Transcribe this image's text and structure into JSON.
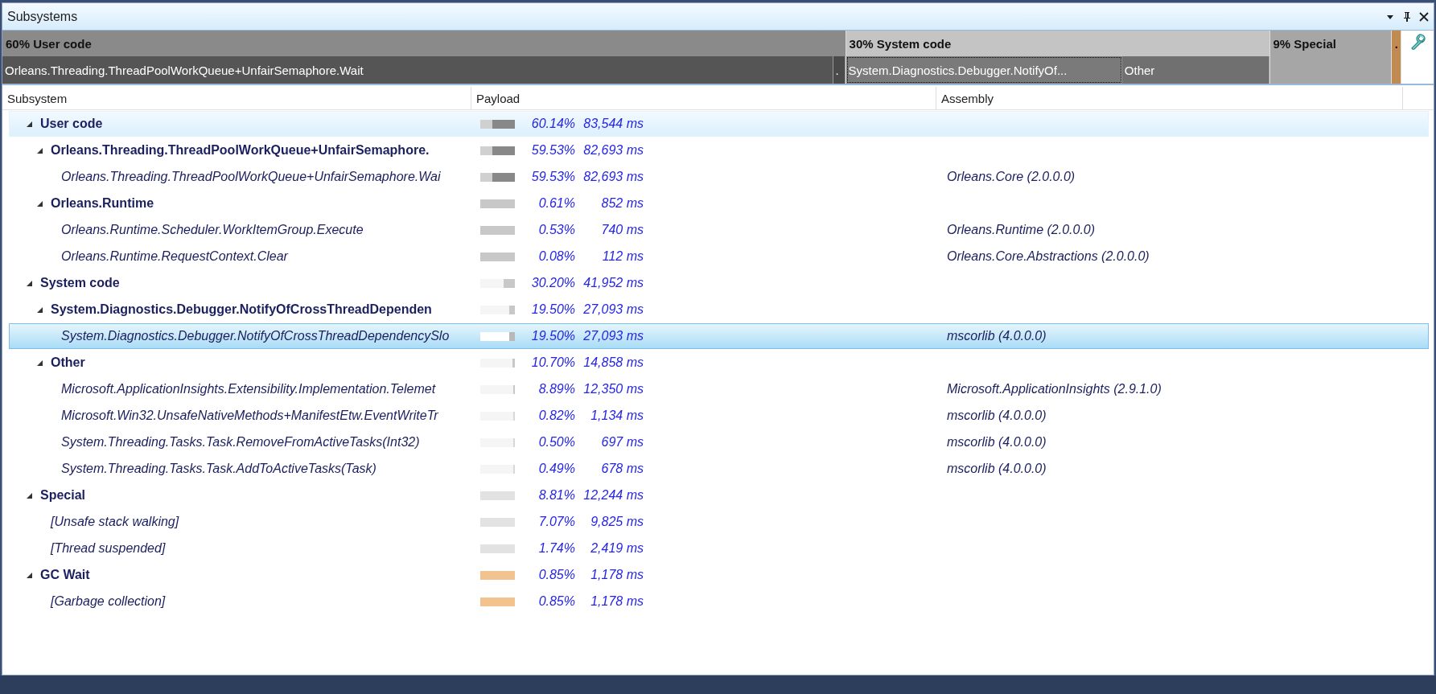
{
  "window": {
    "title": "Subsystems"
  },
  "breakdown": [
    {
      "label": "60% User code",
      "color": "#8a8a8a",
      "parts": [
        {
          "label": "Orleans.Threading.ThreadPoolWorkQueue+UnfairSemaphore.Wait",
          "color": "#555555",
          "selected": false
        },
        {
          "label": ".",
          "color": "#4a4a4a",
          "selected": false
        }
      ]
    },
    {
      "label": "30% System code",
      "color": "#c4c4c4",
      "parts": [
        {
          "label": "System.Diagnostics.Debugger.NotifyOf...",
          "color": "#7a7a7a",
          "selected": true
        },
        {
          "label": "Other",
          "color": "#707070",
          "selected": false
        }
      ]
    },
    {
      "label": "9% Special",
      "color": "#a6a6a6"
    },
    {
      "label": ".",
      "color": "#c08a50"
    }
  ],
  "table": {
    "columns": [
      "Subsystem",
      "Payload",
      "Assembly"
    ],
    "rows": [
      {
        "name": "User code",
        "expanded": true,
        "selected": false,
        "hovered": true,
        "percent": "60.14%",
        "time": "83,544 ms",
        "bar": {
          "kind": "split",
          "level": 0.65,
          "color": "#888888"
        },
        "children": [
          {
            "name": "Orleans.Threading.ThreadPoolWorkQueue+UnfairSemaphore.",
            "expanded": true,
            "selected": false,
            "hovered": false,
            "percent": "59.53%",
            "time": "82,693 ms",
            "bar": {
              "kind": "split",
              "level": 0.65,
              "color": "#888888"
            },
            "children": [
              {
                "name": "Orleans.Threading.ThreadPoolWorkQueue+UnfairSemaphore.Wai",
                "selected": false,
                "hovered": false,
                "percent": "59.53%",
                "time": "82,693 ms",
                "assembly": "Orleans.Core (2.0.0.0)",
                "bar": {
                  "kind": "split",
                  "level": 0.65,
                  "color": "#888888"
                }
              }
            ]
          },
          {
            "name": "Orleans.Runtime",
            "expanded": true,
            "selected": false,
            "hovered": false,
            "percent": "0.61%",
            "time": "852 ms",
            "bar": {
              "kind": "plain",
              "level": 1,
              "color": "#c8c8c8"
            },
            "children": [
              {
                "name": "Orleans.Runtime.Scheduler.WorkItemGroup.Execute",
                "selected": false,
                "hovered": false,
                "percent": "0.53%",
                "time": "740 ms",
                "assembly": "Orleans.Runtime (2.0.0.0)",
                "bar": {
                  "kind": "plain",
                  "level": 1,
                  "color": "#c8c8c8"
                }
              },
              {
                "name": "Orleans.Runtime.RequestContext.Clear",
                "selected": false,
                "hovered": false,
                "percent": "0.08%",
                "time": "112 ms",
                "assembly": "Orleans.Core.Abstractions (2.0.0.0)",
                "bar": {
                  "kind": "plain",
                  "level": 1,
                  "color": "#c8c8c8"
                }
              }
            ]
          }
        ]
      },
      {
        "name": "System code",
        "expanded": true,
        "selected": false,
        "hovered": false,
        "percent": "30.20%",
        "time": "41,952 ms",
        "bar": {
          "kind": "plain",
          "level": 0.33,
          "color": "#c8c8c8"
        },
        "children": [
          {
            "name": "System.Diagnostics.Debugger.NotifyOfCrossThreadDependen",
            "expanded": true,
            "selected": false,
            "hovered": false,
            "percent": "19.50%",
            "time": "27,093 ms",
            "bar": {
              "kind": "plain",
              "level": 0.16,
              "color": "#c8c8c8"
            },
            "children": [
              {
                "name": "System.Diagnostics.Debugger.NotifyOfCrossThreadDependencySlo",
                "selected": true,
                "hovered": false,
                "percent": "19.50%",
                "time": "27,093 ms",
                "assembly": "mscorlib (4.0.0.0)",
                "bar": {
                  "kind": "split",
                  "level": 0.16,
                  "color": "#b8b8b8"
                }
              }
            ]
          },
          {
            "name": "Other",
            "expanded": true,
            "selected": false,
            "hovered": false,
            "percent": "10.70%",
            "time": "14,858 ms",
            "bar": {
              "kind": "plain",
              "level": 0.06,
              "color": "#c8c8c8"
            },
            "children": [
              {
                "name": "Microsoft.ApplicationInsights.Extensibility.Implementation.Telemet",
                "selected": false,
                "hovered": false,
                "percent": "8.89%",
                "time": "12,350 ms",
                "assembly": "Microsoft.ApplicationInsights (2.9.1.0)",
                "bar": {
                  "kind": "plain",
                  "level": 0.05,
                  "color": "#c8c8c8"
                }
              },
              {
                "name": "Microsoft.Win32.UnsafeNativeMethods+ManifestEtw.EventWriteTr",
                "selected": false,
                "hovered": false,
                "percent": "0.82%",
                "time": "1,134 ms",
                "assembly": "mscorlib (4.0.0.0)",
                "bar": {
                  "kind": "plain",
                  "level": 0.04,
                  "color": "#d8d8d8"
                }
              },
              {
                "name": "System.Threading.Tasks.Task.RemoveFromActiveTasks(Int32)",
                "selected": false,
                "hovered": false,
                "percent": "0.50%",
                "time": "697 ms",
                "assembly": "mscorlib (4.0.0.0)",
                "bar": {
                  "kind": "plain",
                  "level": 0.04,
                  "color": "#d8d8d8"
                }
              },
              {
                "name": "System.Threading.Tasks.Task.AddToActiveTasks(Task)",
                "selected": false,
                "hovered": false,
                "percent": "0.49%",
                "time": "678 ms",
                "assembly": "mscorlib (4.0.0.0)",
                "bar": {
                  "kind": "plain",
                  "level": 0.04,
                  "color": "#d8d8d8"
                }
              }
            ]
          }
        ]
      },
      {
        "name": "Special",
        "expanded": true,
        "selected": false,
        "hovered": false,
        "percent": "8.81%",
        "time": "12,244 ms",
        "bar": {
          "kind": "plain",
          "level": 1,
          "color": "#e2e2e2"
        },
        "children": [
          {
            "name": "[Unsafe stack walking]",
            "selected": false,
            "hovered": false,
            "percent": "7.07%",
            "time": "9,825 ms",
            "bar": {
              "kind": "plain",
              "level": 1,
              "color": "#e2e2e2"
            }
          },
          {
            "name": "[Thread suspended]",
            "selected": false,
            "hovered": false,
            "percent": "1.74%",
            "time": "2,419 ms",
            "bar": {
              "kind": "plain",
              "level": 1,
              "color": "#e2e2e2"
            }
          }
        ]
      },
      {
        "name": "GC Wait",
        "expanded": true,
        "selected": false,
        "hovered": false,
        "percent": "0.85%",
        "time": "1,178 ms",
        "bar": {
          "kind": "plain",
          "level": 1,
          "color": "#f2c38e"
        },
        "children": [
          {
            "name": "[Garbage collection]",
            "selected": false,
            "hovered": false,
            "percent": "0.85%",
            "time": "1,178 ms",
            "bar": {
              "kind": "plain",
              "level": 1,
              "color": "#f2c38e"
            }
          }
        ]
      }
    ]
  }
}
